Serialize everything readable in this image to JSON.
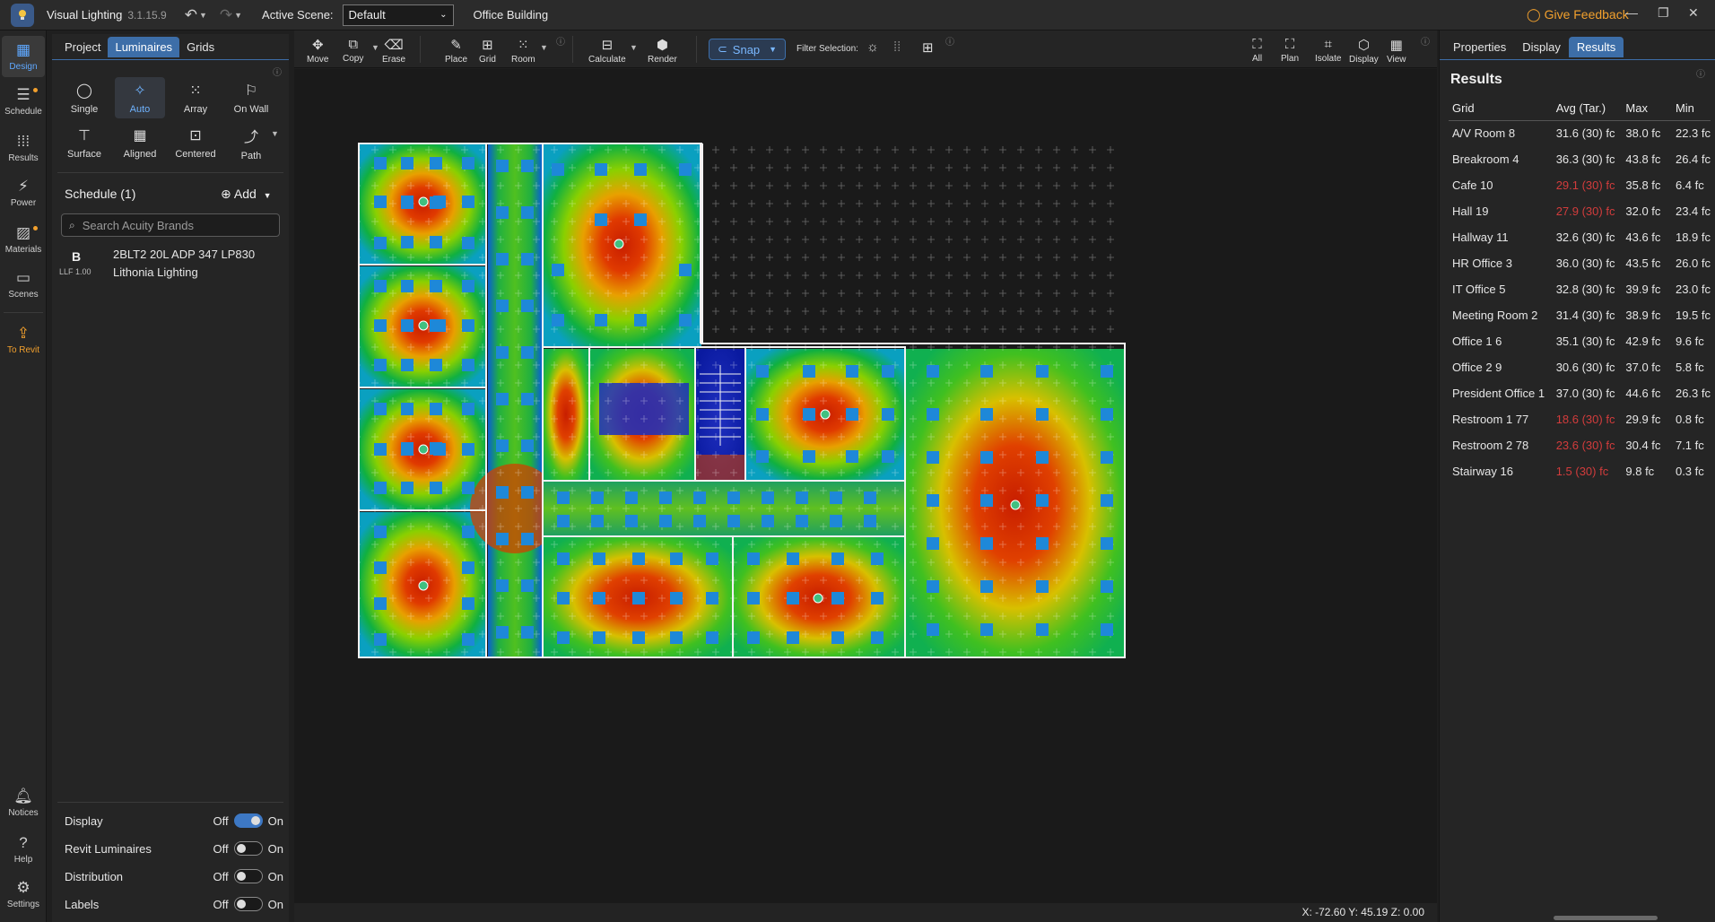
{
  "titlebar": {
    "app_name": "Visual Lighting",
    "version": "3.1.15.9",
    "active_scene_label": "Active Scene:",
    "active_scene_value": "Default",
    "project_name": "Office Building",
    "feedback_label": "Give Feedback"
  },
  "left_rail": {
    "items": [
      {
        "label": "Design"
      },
      {
        "label": "Schedule"
      },
      {
        "label": "Results"
      },
      {
        "label": "Power"
      },
      {
        "label": "Materials"
      },
      {
        "label": "Scenes"
      },
      {
        "label": "To Revit"
      }
    ],
    "bottom_items": [
      {
        "label": "Notices"
      },
      {
        "label": "Help"
      },
      {
        "label": "Settings"
      }
    ]
  },
  "left_panel": {
    "tabs": [
      "Project",
      "Luminaires",
      "Grids"
    ],
    "active_tab": "Luminaires",
    "tools": [
      {
        "label": "Single",
        "icon": "circle-icon"
      },
      {
        "label": "Auto",
        "icon": "magic-wand-icon"
      },
      {
        "label": "Array",
        "icon": "grid-dots-icon"
      },
      {
        "label": "On Wall",
        "icon": "wall-mount-icon"
      },
      {
        "label": "Surface",
        "icon": "surface-icon"
      },
      {
        "label": "Aligned",
        "icon": "aligned-icon"
      },
      {
        "label": "Centered",
        "icon": "centered-icon"
      },
      {
        "label": "Path",
        "icon": "path-icon"
      }
    ],
    "schedule_title": "Schedule (1)",
    "add_label": "Add",
    "search_placeholder": "Search Acuity Brands",
    "luminaire": {
      "letter": "B",
      "llf": "LLF 1.00",
      "name": "2BLT2 20L ADP 347 LP830",
      "manufacturer": "Lithonia Lighting"
    },
    "toggles": [
      {
        "label": "Display",
        "off": "Off",
        "on": "On",
        "state": true
      },
      {
        "label": "Revit Luminaires",
        "off": "Off",
        "on": "On",
        "state": false
      },
      {
        "label": "Distribution",
        "off": "Off",
        "on": "On",
        "state": false
      },
      {
        "label": "Labels",
        "off": "Off",
        "on": "On",
        "state": false
      }
    ]
  },
  "toolbar": {
    "move": "Move",
    "copy": "Copy",
    "erase": "Erase",
    "place": "Place",
    "grid": "Grid",
    "room": "Room",
    "calculate": "Calculate",
    "render": "Render",
    "snap": "Snap",
    "filter_selection": "Filter Selection:",
    "all": "All",
    "plan": "Plan",
    "isolate": "Isolate",
    "display": "Display",
    "view": "View"
  },
  "status": {
    "coords": "X: -72.60 Y: 45.19 Z: 0.00"
  },
  "right_panel": {
    "tabs": [
      "Properties",
      "Display",
      "Results"
    ],
    "active_tab": "Results",
    "title": "Results",
    "columns": [
      "Grid",
      "Avg (Tar.)",
      "Max",
      "Min"
    ],
    "rows": [
      {
        "grid": "A/V Room 8",
        "avg": "31.6 (30) fc",
        "max": "38.0 fc",
        "min": "22.3 fc",
        "low": false
      },
      {
        "grid": "Breakroom 4",
        "avg": "36.3 (30) fc",
        "max": "43.8 fc",
        "min": "26.4 fc",
        "low": false
      },
      {
        "grid": "Cafe 10",
        "avg": "29.1 (30) fc",
        "max": "35.8 fc",
        "min": "6.4 fc",
        "low": true
      },
      {
        "grid": "Hall 19",
        "avg": "27.9 (30) fc",
        "max": "32.0 fc",
        "min": "23.4 fc",
        "low": true
      },
      {
        "grid": "Hallway 11",
        "avg": "32.6 (30) fc",
        "max": "43.6 fc",
        "min": "18.9 fc",
        "low": false
      },
      {
        "grid": "HR Office 3",
        "avg": "36.0 (30) fc",
        "max": "43.5 fc",
        "min": "26.0 fc",
        "low": false
      },
      {
        "grid": "IT Office 5",
        "avg": "32.8 (30) fc",
        "max": "39.9 fc",
        "min": "23.0 fc",
        "low": false
      },
      {
        "grid": "Meeting Room 2",
        "avg": "31.4 (30) fc",
        "max": "38.9 fc",
        "min": "19.5 fc",
        "low": false
      },
      {
        "grid": "Office 1 6",
        "avg": "35.1 (30) fc",
        "max": "42.9 fc",
        "min": "9.6 fc",
        "low": false
      },
      {
        "grid": "Office 2 9",
        "avg": "30.6 (30) fc",
        "max": "37.0 fc",
        "min": "5.8 fc",
        "low": false
      },
      {
        "grid": "President Office 1",
        "avg": "37.0 (30) fc",
        "max": "44.6 fc",
        "min": "26.3 fc",
        "low": false
      },
      {
        "grid": "Restroom 1 77",
        "avg": "18.6 (30) fc",
        "max": "29.9 fc",
        "min": "0.8 fc",
        "low": true
      },
      {
        "grid": "Restroom 2 78",
        "avg": "23.6 (30) fc",
        "max": "30.4 fc",
        "min": "7.1 fc",
        "low": true
      },
      {
        "grid": "Stairway 16",
        "avg": "1.5 (30) fc",
        "max": "9.8 fc",
        "min": "0.3 fc",
        "low": true
      }
    ]
  },
  "colors": {
    "accent": "#3d6ea8",
    "feedback": "#f2a02d",
    "below_target": "#d23c3c"
  }
}
